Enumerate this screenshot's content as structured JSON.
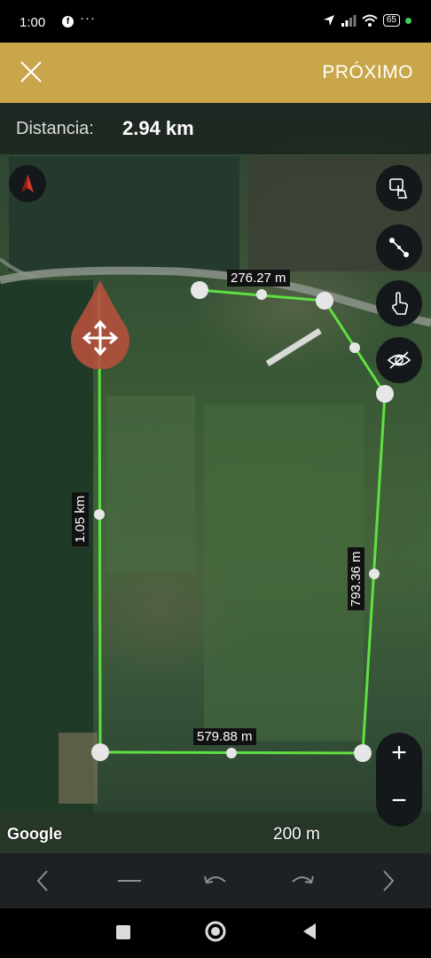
{
  "status_bar": {
    "time": "1:00",
    "dots": "···",
    "battery": "65",
    "facebook_icon": "facebook-icon",
    "location_icon": "location-arrow-icon",
    "signal_icon": "signal-icon",
    "wifi_icon": "wifi-icon"
  },
  "top_bar": {
    "close_icon": "close-icon",
    "next_label": "PRÓXIMO",
    "background": "#c9a64a"
  },
  "distance": {
    "label": "Distancia:",
    "value": "2.94 km"
  },
  "map": {
    "compass_icon": "compass-icon",
    "tools": [
      "tap-gesture-icon",
      "line-measure-icon",
      "hand-pointer-icon",
      "eye-off-icon"
    ],
    "move_icon": "move-arrows-icon",
    "segments": [
      {
        "label": "276.27 m"
      },
      {
        "label": "1.05 km"
      },
      {
        "label": "793.36 m"
      },
      {
        "label": "579.88 m"
      }
    ],
    "line_color": "#5fe042",
    "zoom_in": "+",
    "zoom_out": "−",
    "attribution": "Google",
    "scale": "200 m"
  },
  "bottom_bar": {
    "icons": [
      "chevron-left-icon",
      "minus-icon",
      "undo-icon",
      "redo-icon",
      "chevron-right-icon"
    ]
  },
  "nav_bar": {
    "icons": [
      "recents-square-icon",
      "home-circle-icon",
      "back-triangle-icon"
    ]
  }
}
